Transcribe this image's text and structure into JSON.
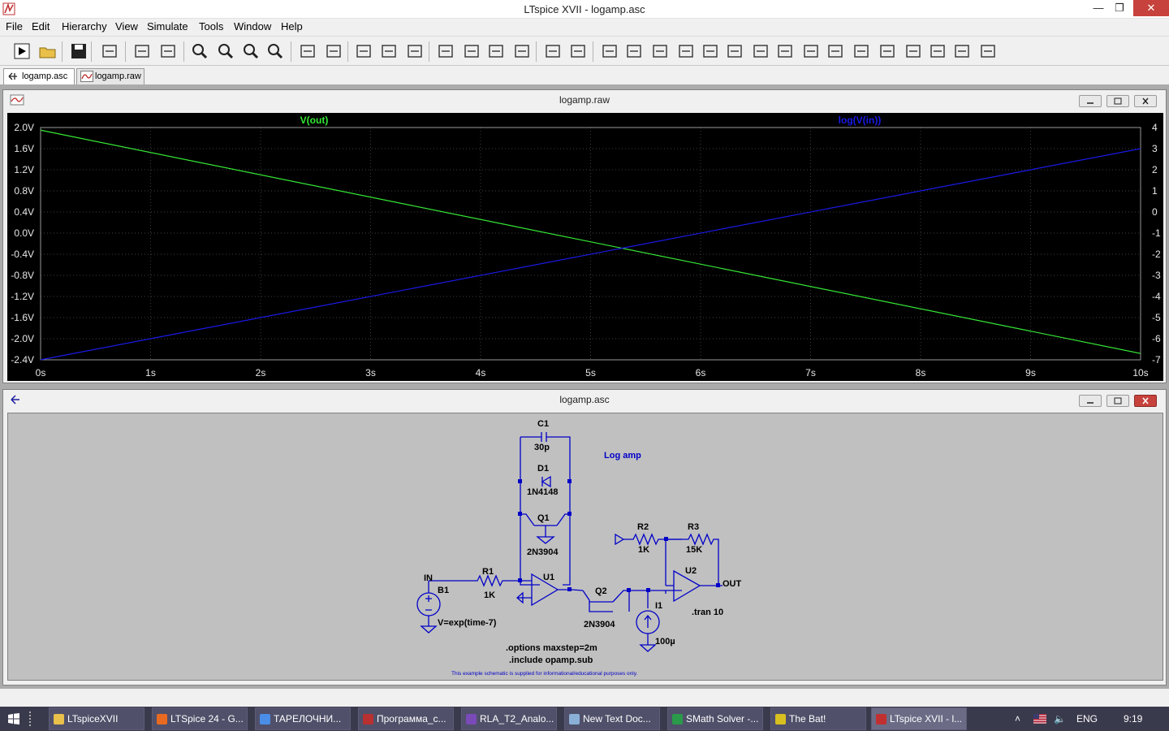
{
  "window": {
    "title": "LTspice XVII - logamp.asc",
    "min_label": "—",
    "max_label": "❐",
    "close_label": "✕"
  },
  "menu": [
    "File",
    "Edit",
    "Hierarchy",
    "View",
    "Simulate",
    "Tools",
    "Window",
    "Help"
  ],
  "toolbar": [
    "run",
    "open",
    "save",
    "control-panel",
    "halt",
    "pan",
    "zoom-in",
    "zoom-fit",
    "zoom-out",
    "zoom-cancel",
    "autorange",
    "plot-settings",
    "tile-horizontal",
    "tile-vertical",
    "cascade",
    "cut",
    "copy",
    "paste",
    "find",
    "print",
    "print-preview",
    "draw-wire",
    "ground",
    "label-net",
    "resistor",
    "capacitor",
    "inductor",
    "diode",
    "component",
    "move",
    "drag",
    "undo",
    "redo",
    "rotate",
    "mirror",
    "text",
    "spice-directive"
  ],
  "tabs": [
    {
      "label": "logamp.asc",
      "icon": "schematic-icon"
    },
    {
      "label": "logamp.raw",
      "icon": "waveform-icon"
    }
  ],
  "plot_window": {
    "title": "logamp.raw"
  },
  "schematic_window": {
    "title": "logamp.asc"
  },
  "chart_data": {
    "type": "line",
    "x": {
      "label": "",
      "range": [
        0,
        10
      ],
      "ticks": [
        "0s",
        "1s",
        "2s",
        "3s",
        "4s",
        "5s",
        "6s",
        "7s",
        "8s",
        "9s",
        "10s"
      ]
    },
    "y_left": {
      "range": [
        -2.4,
        2.0
      ],
      "ticks": [
        "2.0V",
        "1.6V",
        "1.2V",
        "0.8V",
        "0.4V",
        "0.0V",
        "-0.4V",
        "-0.8V",
        "-1.2V",
        "-1.6V",
        "-2.0V",
        "-2.4V"
      ]
    },
    "y_right": {
      "range": [
        -7,
        4
      ],
      "ticks": [
        "4",
        "3",
        "2",
        "1",
        "0",
        "-1",
        "-2",
        "-3",
        "-4",
        "-5",
        "-6",
        "-7"
      ]
    },
    "series": [
      {
        "name": "V(out)",
        "color": "#35e835",
        "axis": "left",
        "x": [
          0,
          10
        ],
        "y": [
          1.95,
          -2.28
        ]
      },
      {
        "name": "log(V(in))",
        "color": "#1a1ae8",
        "axis": "right",
        "x": [
          0,
          10
        ],
        "y": [
          -7.0,
          3.0
        ]
      }
    ],
    "grid": true,
    "background": "#000000"
  },
  "schematic": {
    "labels": {
      "c1": "C1",
      "c1v": "30p",
      "d1": "D1",
      "d1v": "1N4148",
      "q1": "Q1",
      "q1v": "2N3904",
      "r1": "R1",
      "r1v": "1K",
      "u1": "U1",
      "q2": "Q2",
      "q2v": "2N3904",
      "r2": "R2",
      "r2v": "1K",
      "r3": "R3",
      "r3v": "15K",
      "u2": "U2",
      "i1": "I1",
      "i1v": "100µ",
      "b1": "B1",
      "b1v": "V=exp(time-7)",
      "in": "IN",
      "out": "OUT",
      "title": "Log amp",
      "tran": ".tran 10",
      "opt": ".options maxstep=2m",
      "inc": ".include opamp.sub",
      "note": "This example schematic is supplied for informational/educational purposes only."
    },
    "colors": {
      "wire": "#0000c8",
      "text": "#000000",
      "note": "#0000c8",
      "background": "#c0c0c0"
    }
  },
  "taskbar": {
    "items": [
      {
        "label": "LTspiceXVII",
        "color": "#e8c04a"
      },
      {
        "label": "LTSpice 24 - G...",
        "color": "#e86a20"
      },
      {
        "label": "ТАРЕЛОЧНИ...",
        "color": "#4a8ee8"
      },
      {
        "label": "Программа_с...",
        "color": "#b83030"
      },
      {
        "label": "RLA_T2_Analo...",
        "color": "#7a4ab8"
      },
      {
        "label": "New Text Doc...",
        "color": "#8ab0d8"
      },
      {
        "label": "SMath Solver -...",
        "color": "#2a9a4a"
      },
      {
        "label": "The Bat!",
        "color": "#d8c020"
      },
      {
        "label": "LTspice XVII - l...",
        "color": "#c03030"
      }
    ],
    "lang": "ENG",
    "clock": "9:19"
  }
}
